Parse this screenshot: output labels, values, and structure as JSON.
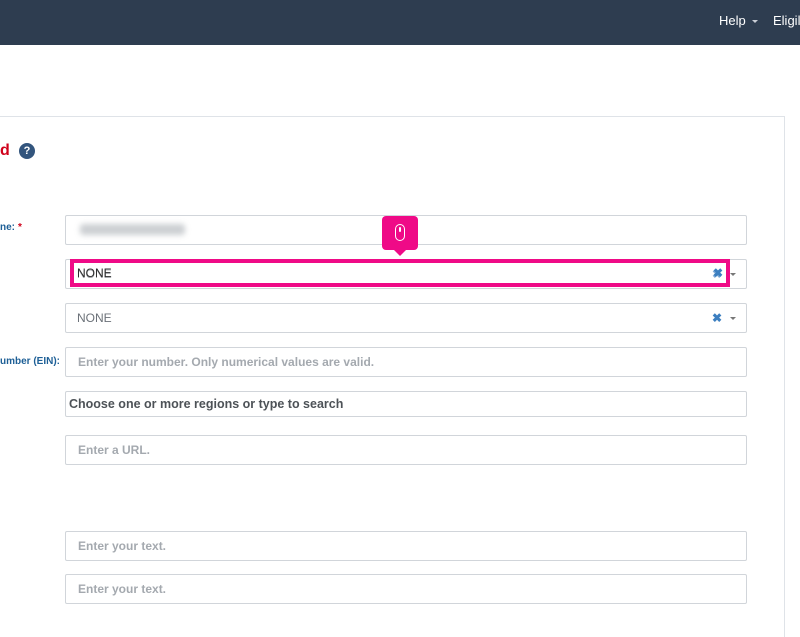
{
  "nav": {
    "help": "Help",
    "eligibility_partial": "Eligil"
  },
  "section": {
    "title_partial": "d",
    "help_glyph": "?"
  },
  "labels": {
    "name_partial": "ne:",
    "name_required": "*",
    "ein_partial": "umber (EIN):"
  },
  "fields": {
    "name_value_blurred": "",
    "select1_value": "NONE",
    "select1_clear": "✖",
    "select2_value": "NONE",
    "select2_clear": "✖",
    "ein_placeholder": "Enter your number. Only numerical values are valid.",
    "regions_placeholder": "Choose one or more regions or type to search",
    "url_placeholder": "Enter a URL.",
    "text1_placeholder": "Enter your text.",
    "text2_placeholder": "Enter your text."
  },
  "colors": {
    "topbar": "#2e3d50",
    "highlight": "#ef0a87",
    "section_title": "#d0021b",
    "label": "#1d5f96"
  },
  "icons": {
    "tooltip": "mouse-icon",
    "help": "question-circle-icon",
    "clear": "close-icon",
    "dropdown": "chevron-down-icon"
  }
}
